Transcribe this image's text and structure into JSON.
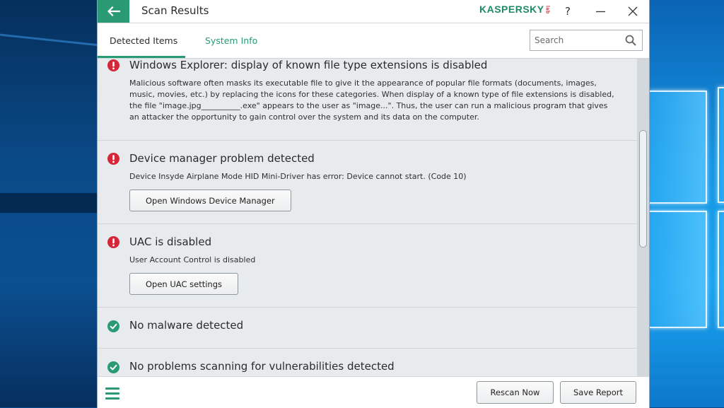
{
  "window": {
    "title": "Scan Results",
    "brand": "KASPERSKY",
    "brand_suffix": "lab",
    "help_label": "?",
    "accent_color": "#2a9a74",
    "warning_color": "#d4283a"
  },
  "tabs": [
    {
      "label": "Detected Items",
      "active": true
    },
    {
      "label": "System Info",
      "active": false
    }
  ],
  "search": {
    "placeholder": "Search",
    "value": ""
  },
  "items": [
    {
      "status": "warning",
      "icon": "exclamation-circle-icon",
      "title": "Windows Explorer: display of known file type extensions is disabled",
      "description": "Malicious software often masks its executable file to give it the appearance of popular file formats (documents, images, music, movies, etc.) by replacing the icons for these categories. When display of a known type of file extensions is disabled, the file \"image.jpg__________.exe\" appears to the user as \"image...\". Thus, the user can run a malicious program that gives an attacker the opportunity to gain control over the system and its data on the computer."
    },
    {
      "status": "warning",
      "icon": "exclamation-circle-icon",
      "title": "Device manager problem detected",
      "description": "Device Insyde Airplane Mode HID Mini-Driver has error: Device cannot start. (Code 10)",
      "action_label": "Open Windows Device Manager"
    },
    {
      "status": "warning",
      "icon": "exclamation-circle-icon",
      "title": "UAC is disabled",
      "description": "User Account Control is disabled",
      "action_label": "Open UAC settings"
    },
    {
      "status": "ok",
      "icon": "check-circle-icon",
      "title": "No malware detected"
    },
    {
      "status": "ok",
      "icon": "check-circle-icon",
      "title": "No problems scanning for vulnerabilities detected"
    }
  ],
  "footer": {
    "rescan_label": "Rescan Now",
    "save_label": "Save Report"
  }
}
